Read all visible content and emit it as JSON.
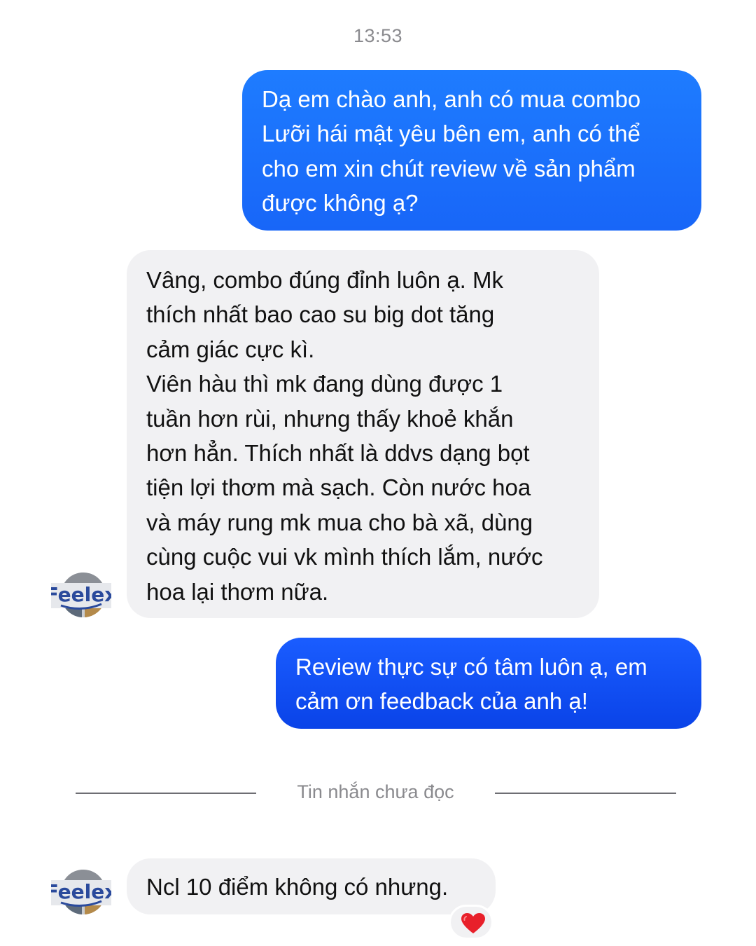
{
  "timestamp": "13:53",
  "messages": [
    {
      "direction": "outgoing",
      "text": "Dạ em chào anh, anh có mua combo\nLưỡi hái mật yêu bên em, anh có thể\ncho em xin chút review về sản phẩm\nđược không ạ?"
    },
    {
      "direction": "incoming",
      "sender_avatar": "Feelex",
      "text": "Vâng, combo đúng đỉnh luôn ạ. Mk\nthích nhất bao cao su big dot tăng\ncảm giác cực kì.\nViên hàu thì mk đang dùng được 1\ntuần hơn rùi, nhưng thấy khoẻ khắn\nhơn hẳn. Thích nhất là ddvs dạng bọt\ntiện lợi thơm mà sạch. Còn nước hoa\nvà máy rung mk mua cho bà xã, dùng\ncùng cuộc vui vk mình thích lắm, nước\nhoa lại thơm nữa."
    },
    {
      "direction": "outgoing",
      "text": "Review thực sự có tâm luôn ạ, em\ncảm ơn feedback của anh ạ!"
    },
    {
      "direction": "incoming",
      "sender_avatar": "Feelex",
      "text": "Ncl 10 điểm không có nhưng.",
      "reaction": "heart-icon"
    }
  ],
  "unread_divider": "Tin nhắn chưa đọc",
  "colors": {
    "outgoing_bubble": "#1a6cfb",
    "outgoing_bubble_dark": "#0a43e8",
    "incoming_bubble": "#f1f1f3",
    "reaction_heart": "#e8202a",
    "avatar_text": "#2a4a9c"
  }
}
